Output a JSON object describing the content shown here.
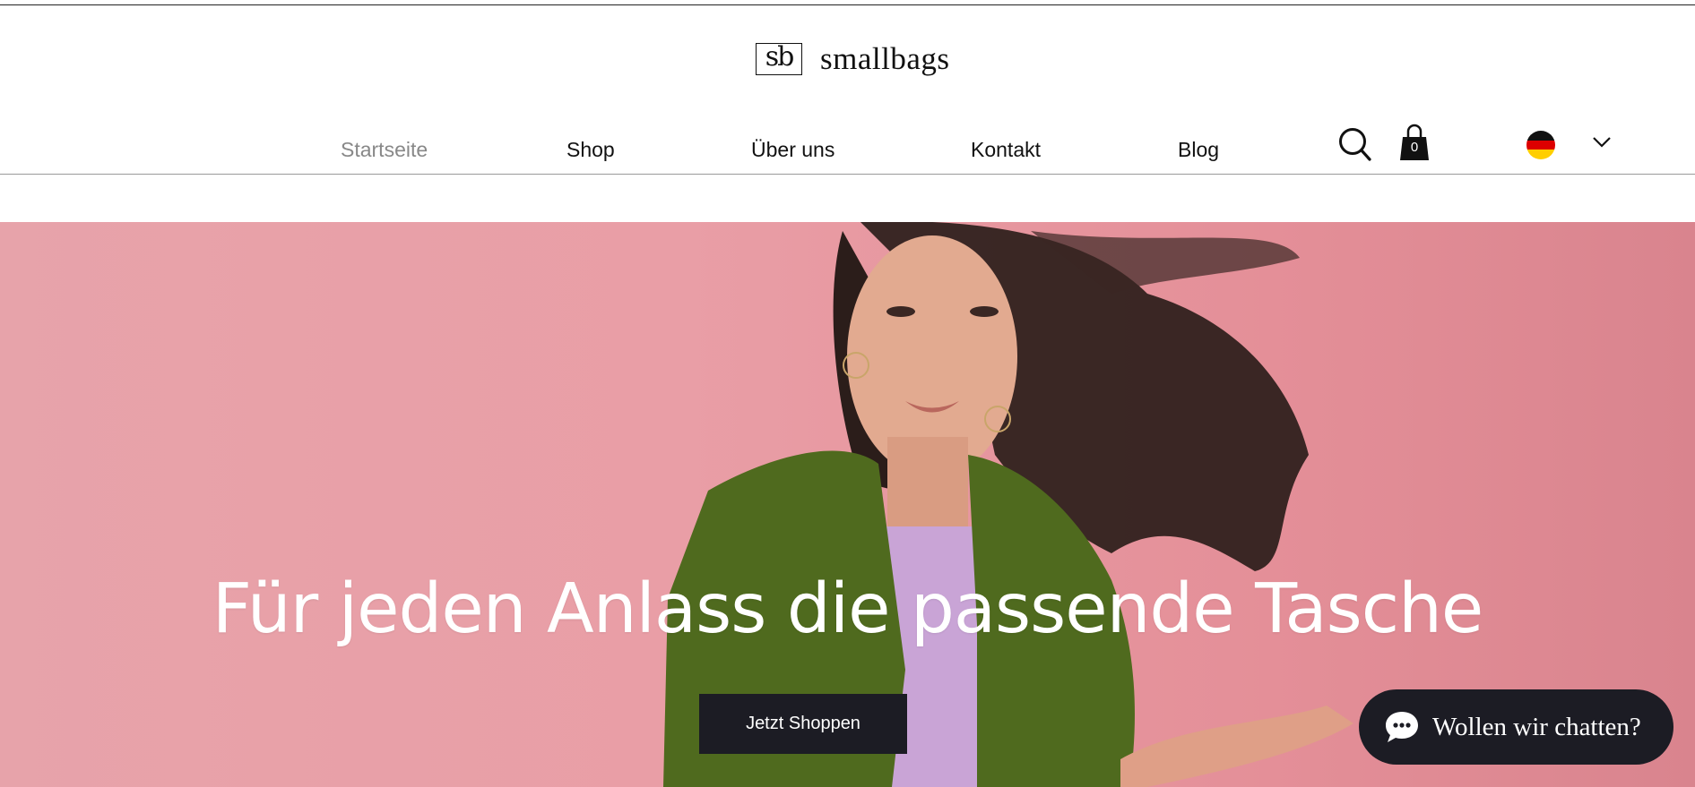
{
  "header": {
    "logo_mark": "sb",
    "logo_text": "smallbags"
  },
  "nav": {
    "items": [
      {
        "label": "Startseite",
        "active": true
      },
      {
        "label": "Shop",
        "active": false
      },
      {
        "label": "Über uns",
        "active": false
      },
      {
        "label": "Kontakt",
        "active": false
      },
      {
        "label": "Blog",
        "active": false
      }
    ]
  },
  "cart": {
    "count": "0"
  },
  "language": {
    "icon": "german-flag-icon"
  },
  "hero": {
    "title": "Für jeden Anlass die passende Tasche",
    "cta_label": "Jetzt Shoppen"
  },
  "chat": {
    "label": "Wollen wir chatten?"
  },
  "colors": {
    "hero_background": "#e99ea6",
    "button_dark": "#1c1c24",
    "nav_active": "#888888"
  }
}
